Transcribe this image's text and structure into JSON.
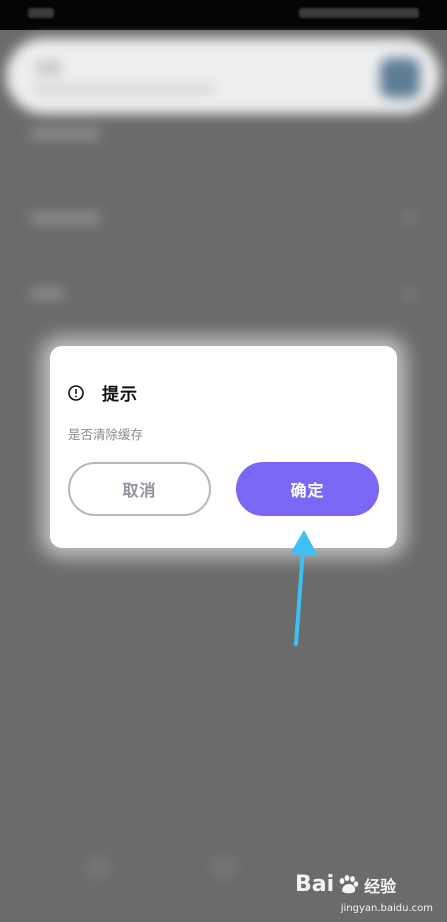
{
  "background": {
    "notification_title": "消息"
  },
  "dialog": {
    "title": "提示",
    "message": "是否清除缓存",
    "cancel_label": "取消",
    "confirm_label": "确定",
    "icon": "info-circle-icon"
  },
  "colors": {
    "confirm_button": "#7a67f5",
    "cancel_border": "#b8b5c2",
    "arrow": "#3ec0f5",
    "overlay": "#6b6b6b"
  },
  "watermark": {
    "logo_text": "Bai",
    "logo_suffix": "经验",
    "url": "jingyan.baidu.com"
  }
}
